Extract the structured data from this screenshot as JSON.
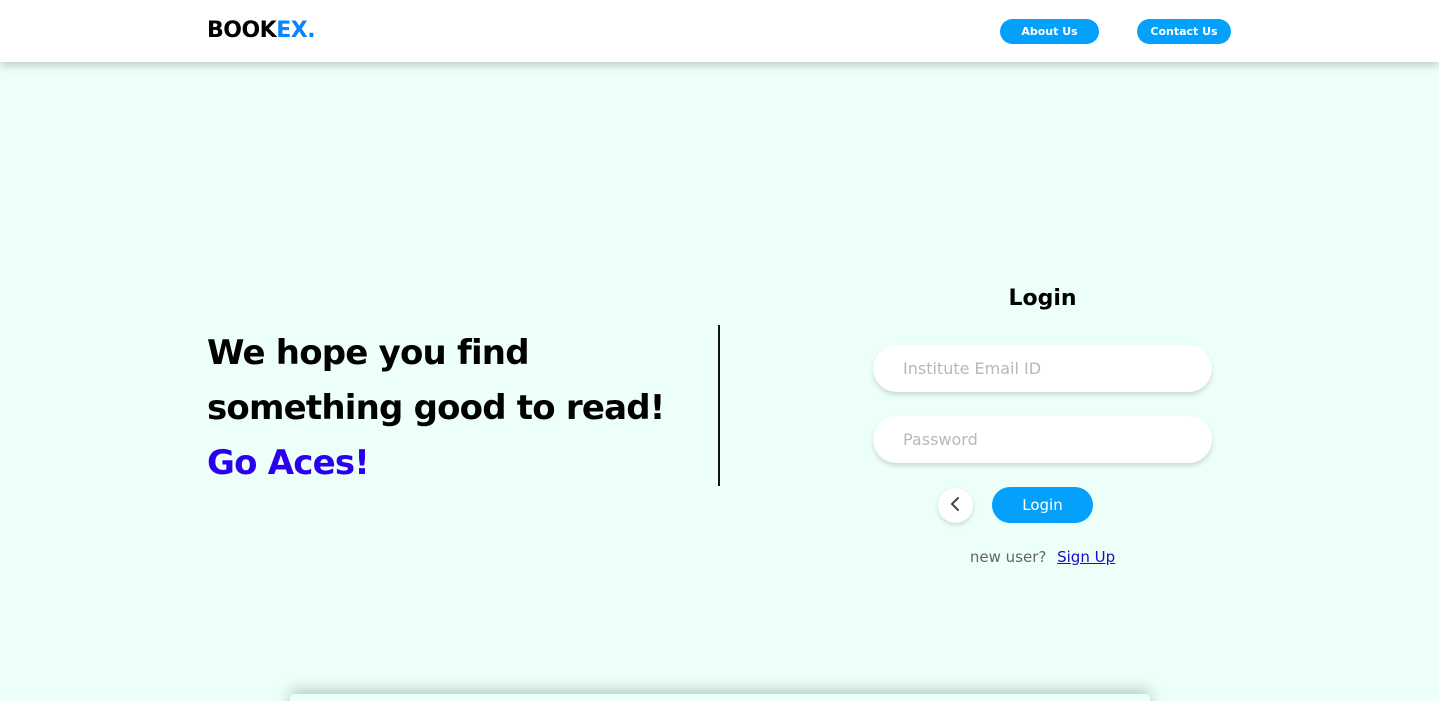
{
  "navbar": {
    "logo_main": "BOOK",
    "logo_accent": "EX.",
    "about_label": "About Us",
    "contact_label": "Contact Us"
  },
  "hero": {
    "line1": "We hope you find",
    "line2": "something good to read!",
    "line3": "Go Aces!"
  },
  "login": {
    "title": "Login",
    "email_placeholder": "Institute Email ID",
    "password_placeholder": "Password",
    "back_icon": "chevron-left-icon",
    "login_label": "Login",
    "signup_prompt": "new user?",
    "signup_link": "Sign Up"
  },
  "colors": {
    "background": "#ecfff8",
    "primary": "#03a1fc",
    "logo_accent": "#0a84ff",
    "hero_accent": "#2b00f0",
    "link": "#1a0dcc"
  }
}
